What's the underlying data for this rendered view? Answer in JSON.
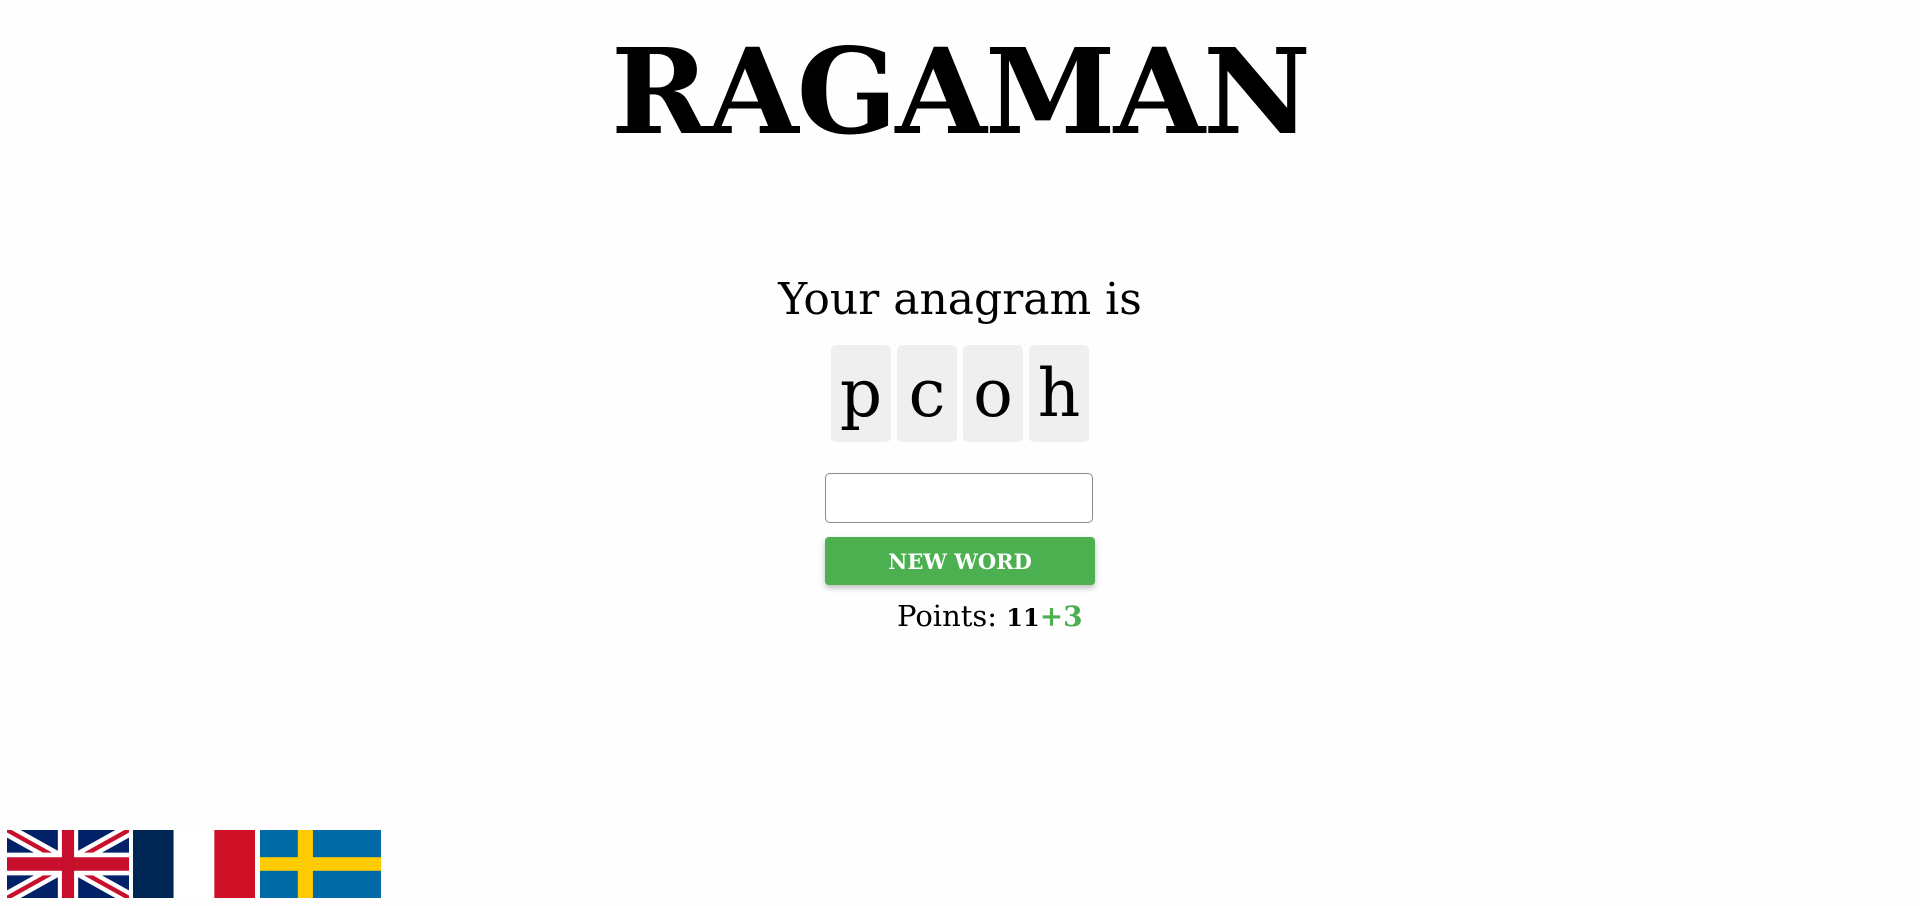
{
  "app": {
    "title": "RAGAMAN"
  },
  "game": {
    "prompt": "Your anagram is",
    "letters": [
      "p",
      "c",
      "o",
      "h"
    ],
    "answer": {
      "value": "",
      "placeholder": ""
    },
    "new_word_label": "NEW WORD",
    "points_label": "Points:",
    "points_value": "11",
    "points_gain": "+3"
  },
  "languages": [
    {
      "name": "english-flag-icon"
    },
    {
      "name": "french-flag-icon"
    },
    {
      "name": "swedish-flag-icon"
    }
  ],
  "colors": {
    "accent": "#4caf50",
    "tile_bg": "#efefef",
    "gb_blue": "#012169",
    "gb_red": "#c8102e",
    "fr_blue": "#002654",
    "fr_red": "#ce1126",
    "se_blue": "#006aa7",
    "se_yellow": "#fecc00"
  }
}
